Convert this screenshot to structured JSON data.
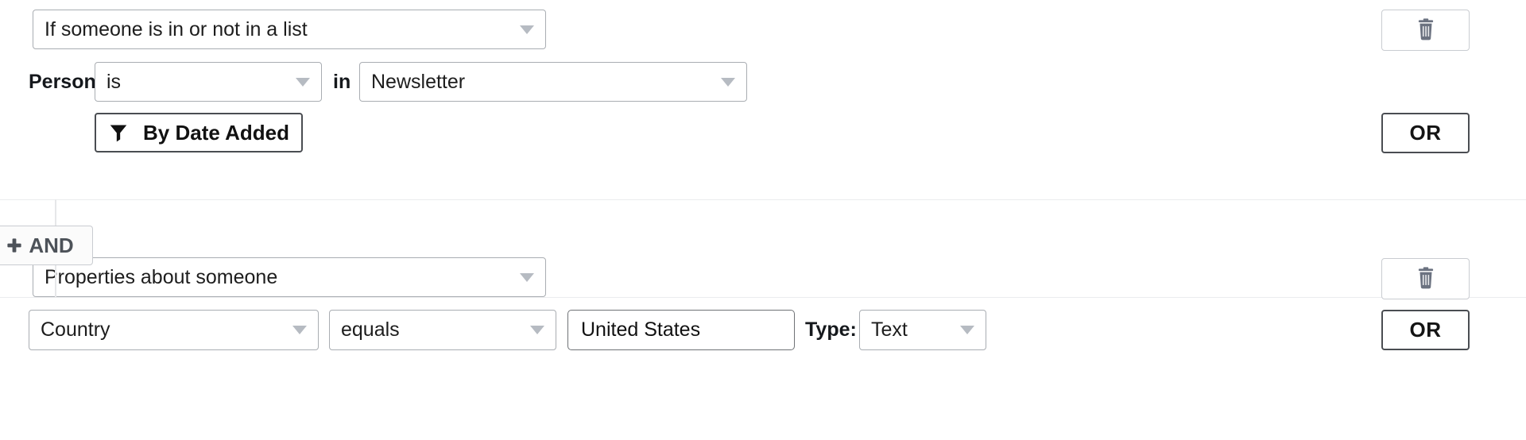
{
  "segment_builder": {
    "groups": [
      {
        "name": "list-membership-group",
        "condition_type": {
          "value": "If someone is in or not in a list",
          "caret_icon": "chevron-down-icon"
        },
        "row": {
          "subject_label": "Person",
          "operator": {
            "value": "is",
            "caret_icon": "chevron-down-icon"
          },
          "preposition_label": "in",
          "list": {
            "value": "Newsletter",
            "caret_icon": "chevron-down-icon"
          }
        },
        "filter_button": {
          "label": "By Date Added",
          "icon": "funnel-icon"
        },
        "delete_button": {
          "icon": "trash-icon"
        },
        "or_button": {
          "label": "OR"
        }
      },
      {
        "name": "properties-group",
        "condition_type": {
          "value": "Properties about someone",
          "caret_icon": "chevron-down-icon"
        },
        "row": {
          "property": {
            "value": "Country",
            "caret_icon": "chevron-down-icon"
          },
          "operator": {
            "value": "equals",
            "caret_icon": "chevron-down-icon"
          },
          "value_input": {
            "value": "United States",
            "placeholder": "Enter a value"
          },
          "type_label": "Type:",
          "type_select": {
            "value": "Text",
            "caret_icon": "chevron-down-icon"
          }
        },
        "delete_button": {
          "icon": "trash-icon"
        },
        "or_button": {
          "label": "OR"
        }
      }
    ],
    "and_button": {
      "label": "AND",
      "icon": "plus-icon"
    },
    "colors": {
      "border_light": "#c9ccd1",
      "border_select": "#a9adb2",
      "border_strong": "#4a4d52",
      "caret": "#b6bbc2",
      "trash": "#6b7280",
      "divider": "#ebecee",
      "connector": "#e6e7e9",
      "and_text": "#4d5259",
      "text": "#1d1d1d"
    }
  }
}
